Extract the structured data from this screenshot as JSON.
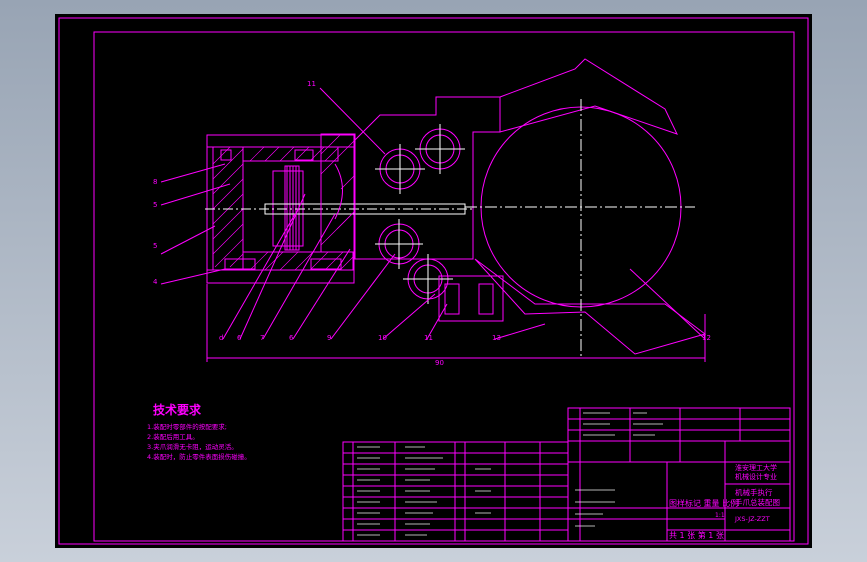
{
  "tech": {
    "title": "技术要求",
    "lines": [
      "1.装配时零部件的按配要求;",
      "2.装配后用工具。",
      "3.夹爪润滑无卡阻，运动灵活。",
      "4.装配时，防止零件表面损伤碰撞。"
    ]
  },
  "callouts": {
    "c11": "11",
    "c8": "8",
    "c5": "5",
    "c5b": "5",
    "c4": "4",
    "cd": "d",
    "c6": "6",
    "c7": "7",
    "c6b": "6",
    "c9": "9",
    "c10": "10",
    "c11b": "11",
    "c13": "13",
    "c12": "12",
    "dim": "90"
  },
  "title_block": {
    "scale_label": "图样标记  重量  比例",
    "scale": "1:1",
    "sheet": "共 1 张  第 1 张",
    "school": "淮安理工大学",
    "dept": "机械设计专业",
    "drawing_title": "机械手执行",
    "drawing_title2": "手爪总装配图",
    "drawing_no": "JXS-JZ-ZZT"
  }
}
